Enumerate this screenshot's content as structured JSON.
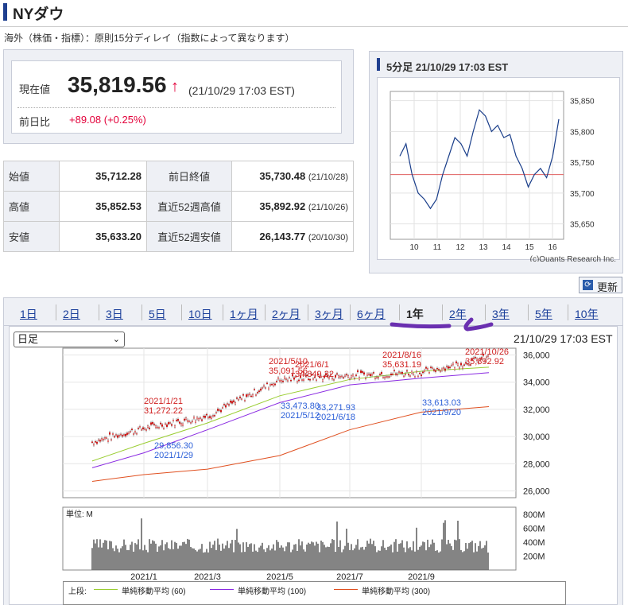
{
  "page": {
    "title": "NYダウ",
    "subtitle": "海外（株価・指標）：原則15分ディレイ（指数によって異なります）"
  },
  "quote": {
    "current_label": "現在値",
    "current_value": "35,819.56",
    "arrow": "↑",
    "timestamp": "(21/10/29 17:03 EST)",
    "change_label": "前日比",
    "change_value": "+89.08 (+0.25%)"
  },
  "stats": {
    "rows": [
      {
        "l1": "始値",
        "v1": "35,712.28",
        "l2": "前日終値",
        "v2": "35,730.48",
        "d2": "(21/10/28)"
      },
      {
        "l1": "高値",
        "v1": "35,852.53",
        "l2": "直近52週高値",
        "v2": "35,892.92",
        "d2": "(21/10/26)"
      },
      {
        "l1": "安値",
        "v1": "35,633.20",
        "l2": "直近52週安値",
        "v2": "26,143.77",
        "d2": "(20/10/30)"
      }
    ]
  },
  "mini_chart": {
    "title": "5分足 21/10/29 17:03 EST",
    "credit": "(c)Quants Research Inc.",
    "x_ticks": [
      "10",
      "11",
      "12",
      "13",
      "14",
      "15",
      "16"
    ],
    "y_ticks": [
      "35,850",
      "35,800",
      "35,750",
      "35,700",
      "35,650"
    ],
    "prev_close": 35730,
    "colors": {
      "line": "#1a3e8a",
      "ref": "#e06060"
    }
  },
  "refresh": {
    "label": "更新",
    "icon": "refresh-icon"
  },
  "tabs": [
    {
      "label": "1日"
    },
    {
      "label": "2日"
    },
    {
      "label": "3日"
    },
    {
      "label": "5日"
    },
    {
      "label": "10日"
    },
    {
      "label": "1ヶ月"
    },
    {
      "label": "2ヶ月"
    },
    {
      "label": "3ヶ月"
    },
    {
      "label": "6ヶ月"
    },
    {
      "label": "1年",
      "active": true
    },
    {
      "label": "2年"
    },
    {
      "label": "3年"
    },
    {
      "label": "5年"
    },
    {
      "label": "10年"
    }
  ],
  "main_chart": {
    "period_select": "日足",
    "timestamp": "21/10/29 17:03 EST",
    "y_ticks": [
      "36,000",
      "34,000",
      "32,000",
      "30,000",
      "28,000",
      "26,000"
    ],
    "x_ticks": [
      "2021/1",
      "2021/3",
      "2021/5",
      "2021/7",
      "2021/9"
    ],
    "volume_unit": "単位: M",
    "volume_ticks": [
      "800M",
      "600M",
      "400M",
      "200M"
    ],
    "annotations_high": [
      {
        "date": "2021/1/21",
        "value": "31,272.22"
      },
      {
        "date": "2021/5/10",
        "value": "35,091.56"
      },
      {
        "date": "2021/6/1",
        "value": "34,849.32"
      },
      {
        "date": "2021/8/16",
        "value": "35,631.19"
      },
      {
        "date": "2021/10/26",
        "value": "35,892.92"
      }
    ],
    "annotations_low": [
      {
        "date": "2021/1/29",
        "value": "29,856.30"
      },
      {
        "date": "2021/5/12",
        "value": "33,473.80"
      },
      {
        "date": "2021/6/18",
        "value": "33,271.93"
      },
      {
        "date": "2021/9/20",
        "value": "33,613.03"
      }
    ],
    "legend_prefix": "上段:",
    "legend": [
      {
        "name": "単純移動平均 (60)",
        "color": "#9acd32"
      },
      {
        "name": "単純移動平均 (100)",
        "color": "#8a2be2"
      },
      {
        "name": "単純移動平均 (300)",
        "color": "#e05020"
      }
    ]
  },
  "chart_data": [
    {
      "type": "line",
      "title": "5分足 21/10/29 17:03 EST",
      "x": [
        "9:30",
        "9:45",
        "10:00",
        "10:15",
        "10:30",
        "10:45",
        "11:00",
        "11:15",
        "11:30",
        "11:45",
        "12:00",
        "12:15",
        "12:30",
        "12:45",
        "13:00",
        "13:15",
        "13:30",
        "13:45",
        "14:00",
        "14:15",
        "14:30",
        "14:45",
        "15:00",
        "15:15",
        "15:30",
        "15:45",
        "16:00"
      ],
      "series": [
        {
          "values": [
            35760,
            35780,
            35730,
            35700,
            35690,
            35675,
            35690,
            35730,
            35760,
            35790,
            35780,
            35760,
            35800,
            35835,
            35825,
            35800,
            35810,
            35790,
            35795,
            35760,
            35740,
            35710,
            35730,
            35740,
            35725,
            35760,
            35820
          ]
        }
      ],
      "ylim": [
        35625,
        35865
      ]
    },
    {
      "type": "line",
      "x": [
        "2020/11",
        "2021/1",
        "2021/3",
        "2021/5",
        "2021/7",
        "2021/9",
        "2021/10"
      ],
      "series": [
        {
          "values": [
            29600,
            30600,
            31500,
            34200,
            34500,
            34700,
            35819
          ]
        },
        {
          "name": "単純移動平均 (60)",
          "values": [
            28200,
            29500,
            31000,
            33000,
            34200,
            34800,
            35100
          ]
        },
        {
          "name": "単純移動平均 (100)",
          "values": [
            27700,
            28800,
            30500,
            32500,
            33800,
            34300,
            34700
          ]
        },
        {
          "name": "単純移動平均 (300)",
          "values": [
            26700,
            27200,
            27600,
            28600,
            30500,
            31800,
            32200
          ]
        }
      ],
      "ylim": [
        25500,
        36500
      ]
    }
  ]
}
